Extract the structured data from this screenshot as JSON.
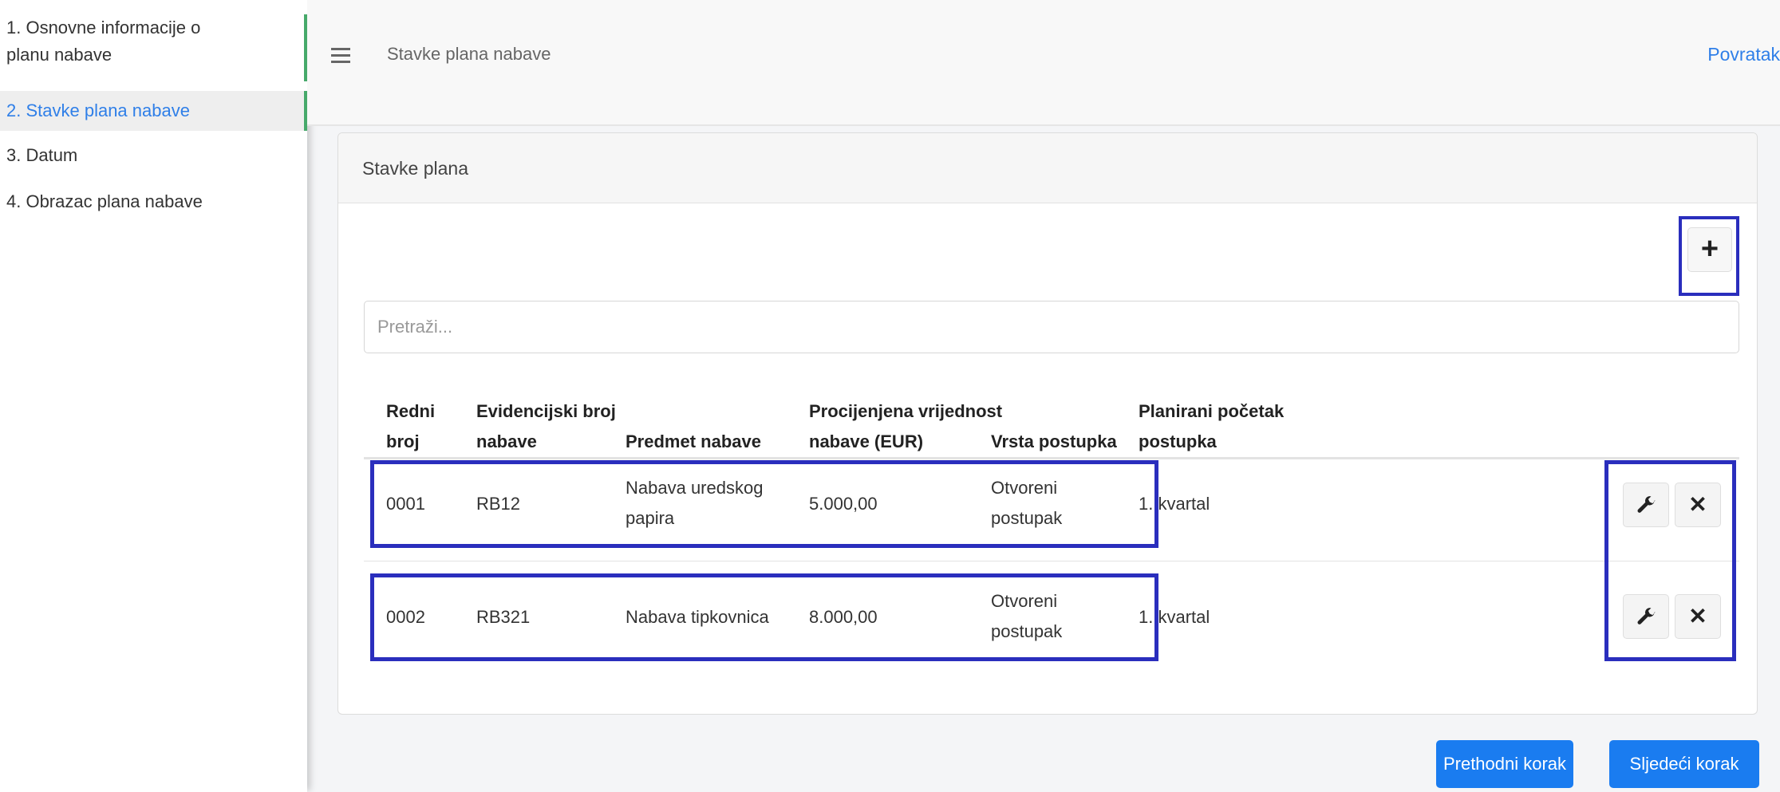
{
  "sidebar": {
    "items": [
      {
        "label": "1. Osnovne informacije o planu nabave",
        "active": false
      },
      {
        "label": "2. Stavke plana nabave",
        "active": true
      },
      {
        "label": "3. Datum",
        "active": false
      },
      {
        "label": "4. Obrazac plana nabave",
        "active": false
      }
    ]
  },
  "header": {
    "menu_icon": "hamburger-icon",
    "title": "Stavke plana nabave",
    "back_label": "Povratak"
  },
  "card": {
    "title": "Stavke plana",
    "add_icon": "plus-icon",
    "search": {
      "placeholder": "Pretraži...",
      "value": ""
    },
    "table": {
      "headers": [
        "Redni broj",
        "Evidencijski broj nabave",
        "Predmet nabave",
        "Procijenjena vrijednost nabave (EUR)",
        "Vrsta postupka",
        "Planirani početak postupka"
      ],
      "rows": [
        {
          "redni_broj": "0001",
          "evidencijski_broj": "RB12",
          "predmet": "Nabava uredskog papira",
          "vrijednost": "5.000,00",
          "vrsta": "Otvoreni postupak",
          "pocetak": "1. kvartal"
        },
        {
          "redni_broj": "0002",
          "evidencijski_broj": "RB321",
          "predmet": "Nabava tipkovnica",
          "vrijednost": "8.000,00",
          "vrsta": "Otvoreni postupak",
          "pocetak": "1. kvartal"
        }
      ],
      "row_actions": [
        {
          "name": "edit",
          "icon": "wrench-icon"
        },
        {
          "name": "delete",
          "icon": "close-icon"
        }
      ]
    }
  },
  "footer": {
    "prev_label": "Prethodni korak",
    "next_label": "Sljedeći korak"
  },
  "colors": {
    "accent": "#1a7cf0",
    "link": "#2f7fe8",
    "highlight_border": "#2a2ebd",
    "active_indicator": "#46a96a"
  }
}
